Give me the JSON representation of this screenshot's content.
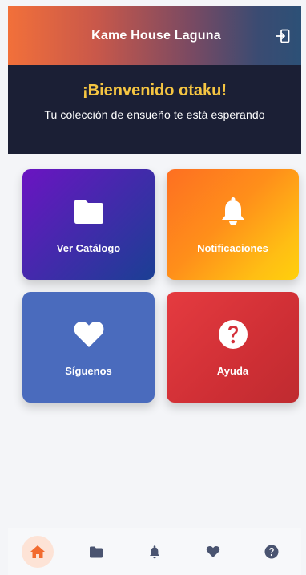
{
  "header": {
    "title": "Kame House Laguna",
    "logout_icon": "logout-icon"
  },
  "welcome": {
    "title": "¡Bienvenido otaku!",
    "subtitle": "Tu colección de ensueño te está esperando"
  },
  "cards": [
    {
      "label": "Ver Catálogo",
      "icon": "folder-icon"
    },
    {
      "label": "Notificaciones",
      "icon": "bell-icon"
    },
    {
      "label": "Síguenos",
      "icon": "heart-icon"
    },
    {
      "label": "Ayuda",
      "icon": "question-circle-icon"
    }
  ],
  "bottom_nav": {
    "items": [
      "home-icon",
      "folder-icon",
      "bell-icon",
      "heart-icon",
      "help-icon"
    ],
    "active": "home-icon"
  },
  "colors": {
    "accent_orange": "#f2703a",
    "banner_bg": "#1b1f35",
    "welcome_yellow": "#f5c542",
    "nav_icon": "#4a5470",
    "nav_active_icon": "#f26b2f"
  }
}
